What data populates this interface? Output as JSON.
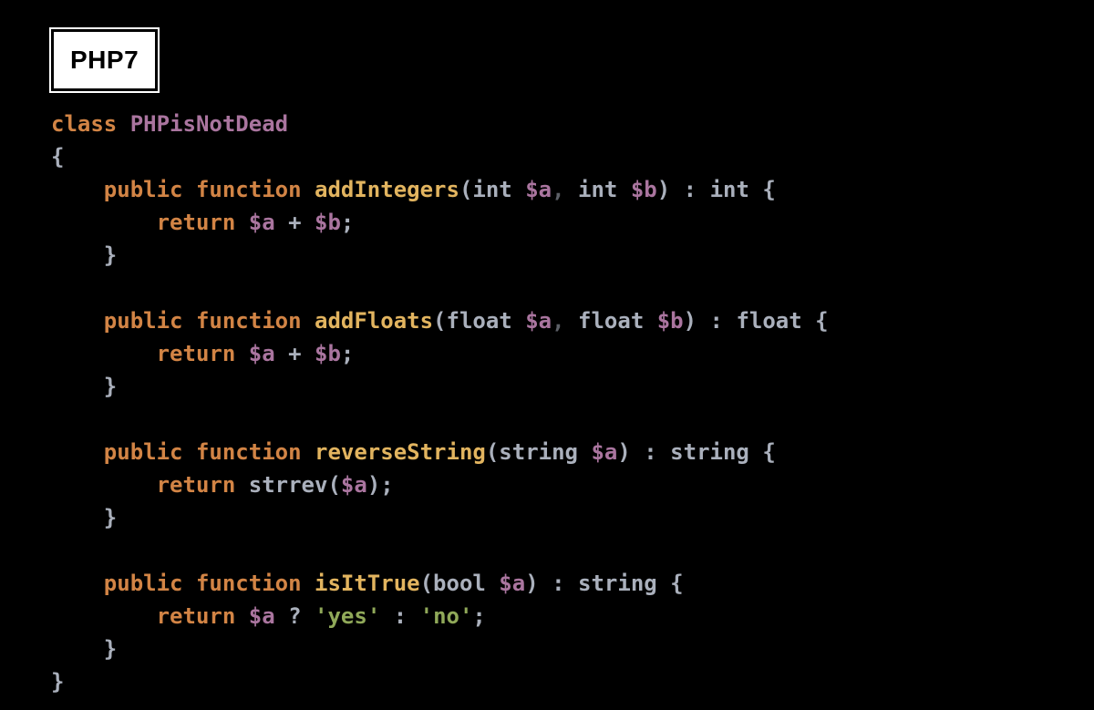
{
  "badge": {
    "text": "PHP7"
  },
  "code": {
    "keywords": {
      "class": "class",
      "public": "public",
      "function": "function",
      "return": "return"
    },
    "class_name": "PHPisNotDead",
    "methods": [
      {
        "name": "addIntegers",
        "params": [
          {
            "type": "int",
            "name": "$a"
          },
          {
            "type": "int",
            "name": "$b"
          }
        ],
        "return_type": "int",
        "body_kind": "add",
        "body_expr": {
          "left": "$a",
          "op": "+",
          "right": "$b"
        }
      },
      {
        "name": "addFloats",
        "params": [
          {
            "type": "float",
            "name": "$a"
          },
          {
            "type": "float",
            "name": "$b"
          }
        ],
        "return_type": "float",
        "body_kind": "add",
        "body_expr": {
          "left": "$a",
          "op": "+",
          "right": "$b"
        }
      },
      {
        "name": "reverseString",
        "params": [
          {
            "type": "string",
            "name": "$a"
          }
        ],
        "return_type": "string",
        "body_kind": "call",
        "body_call": {
          "fn": "strrev",
          "arg": "$a"
        }
      },
      {
        "name": "isItTrue",
        "params": [
          {
            "type": "bool",
            "name": "$a"
          }
        ],
        "return_type": "string",
        "body_kind": "ternary",
        "body_ternary": {
          "cond": "$a",
          "true": "'yes'",
          "false": "'no'"
        }
      }
    ]
  }
}
